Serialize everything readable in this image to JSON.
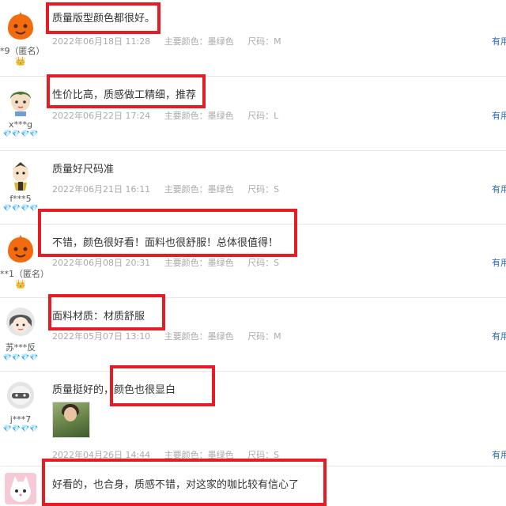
{
  "reviews": [
    {
      "user": "*9（匿名）",
      "badge": "👑",
      "text": "质量版型颜色都很好。",
      "date": "2022年06月18日 11:28",
      "color": "主要颜色：墨绿色",
      "size": "尺码：M",
      "useful": "有用"
    },
    {
      "user": "x***g",
      "badge": "💎💎💎💎",
      "text": "性价比高，质感做工精细，推荐",
      "date": "2022年06月22日 17:24",
      "color": "主要颜色：墨绿色",
      "size": "尺码：L",
      "useful": "有用"
    },
    {
      "user": "f***5",
      "badge": "💎💎💎💎",
      "text": "质量好尺码准",
      "date": "2022年06月21日 16:11",
      "color": "主要颜色：墨绿色",
      "size": "尺码：S",
      "useful": "有用"
    },
    {
      "user": "**1（匿名）",
      "badge": "👑",
      "text": "不错，颜色很好看！面料也很舒服！总体很值得！",
      "date": "2022年06月08日 20:31",
      "color": "主要颜色：墨绿色",
      "size": "尺码：S",
      "useful": "有用"
    },
    {
      "user": "苏***反",
      "badge": "💎💎💎💎",
      "text": "面料材质：材质舒服",
      "date": "2022年05月07日 13:10",
      "color": "主要颜色：墨绿色",
      "size": "尺码：M",
      "useful": "有用"
    },
    {
      "user": "j***7",
      "badge": "💎💎💎💎",
      "text": "质量挺好的，颜色也很显白",
      "date": "2022年04月26日 14:44",
      "color": "主要颜色：墨绿色",
      "size": "尺码：S",
      "useful": "有用"
    },
    {
      "user": "",
      "badge": "",
      "text": "好看的，也合身，质感不错，对这家的咖比较有信心了",
      "date": "",
      "color": "",
      "size": "",
      "useful": ""
    }
  ]
}
